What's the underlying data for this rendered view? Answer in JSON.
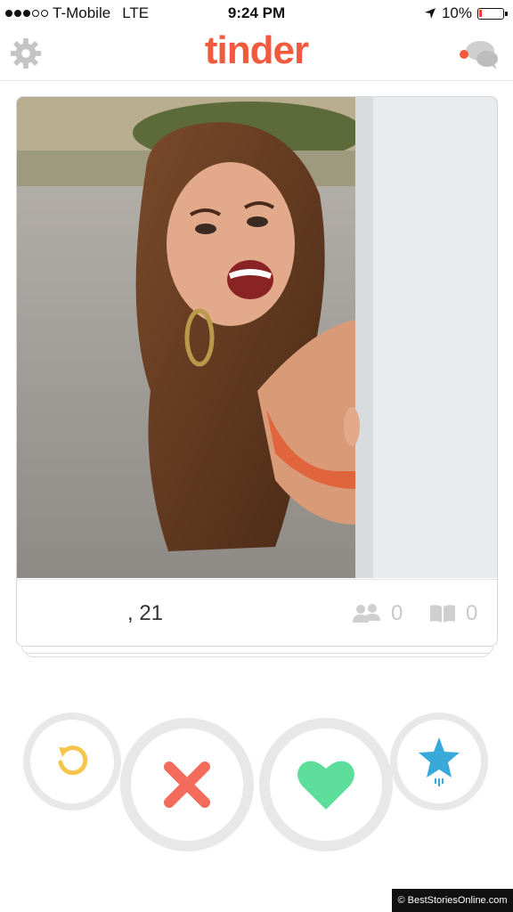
{
  "status_bar": {
    "carrier": "T-Mobile",
    "network": "LTE",
    "time": "9:24 PM",
    "battery": "10%",
    "battery_level": 0.1,
    "signal_bars": 3
  },
  "nav": {
    "logo": "tinder",
    "left_icon": "gear-icon",
    "right_icon": "chat-icon",
    "accent_color": "#f25a3e"
  },
  "card": {
    "name_age": ", 21",
    "common_friends_count": "0",
    "common_interests_count": "0"
  },
  "actions": {
    "rewind_color": "#f5c64a",
    "nope_color": "#f26b5b",
    "like_color": "#5ede9b",
    "superlike_color": "#38a9d8"
  },
  "watermark": "© BestStoriesOnline.com"
}
